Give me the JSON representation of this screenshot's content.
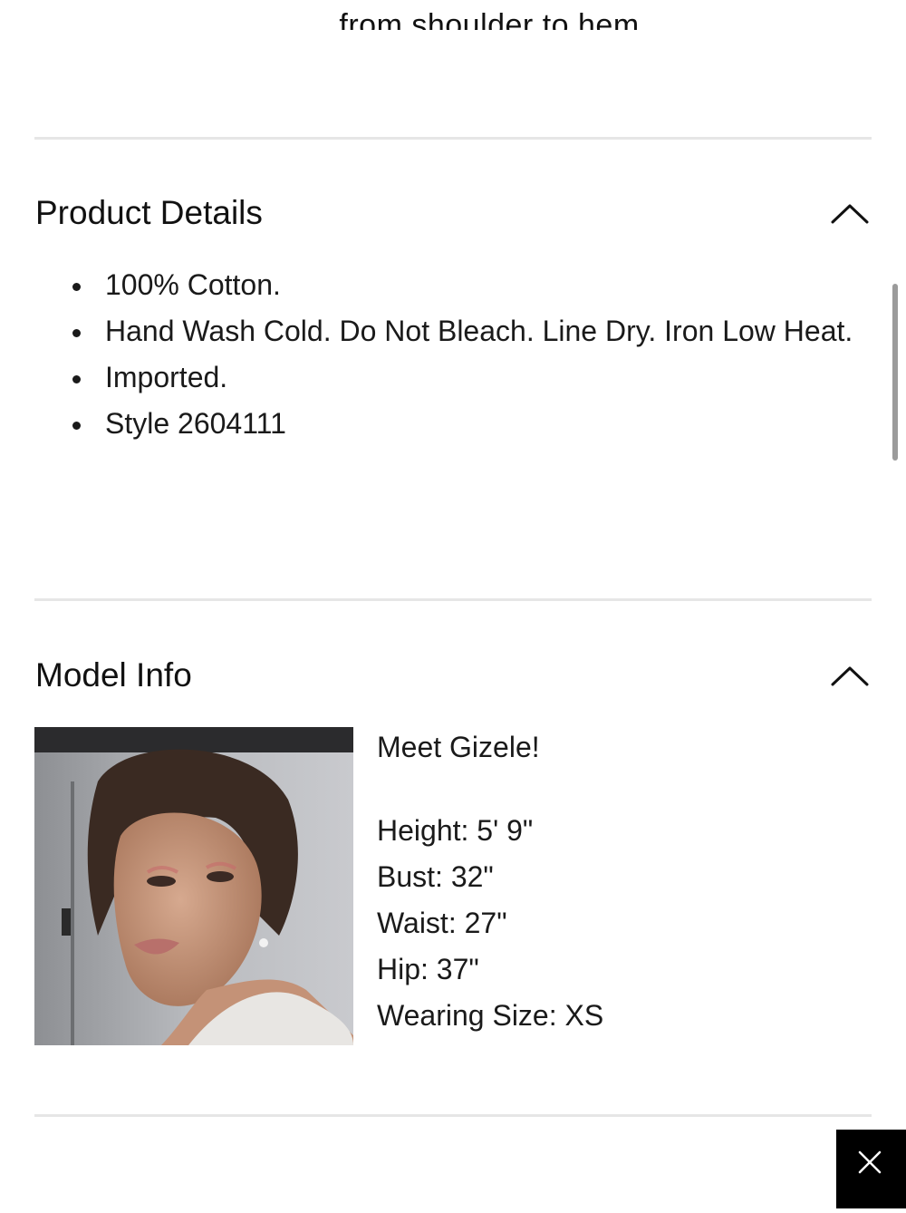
{
  "size_guide_tail": "from shoulder to hem.",
  "product_details": {
    "title": "Product Details",
    "toggle_icon": "chevron-up-icon",
    "items": [
      "100% Cotton.",
      "Hand Wash Cold. Do Not Bleach. Line Dry. Iron Low Heat.",
      "Imported.",
      "Style 2604111"
    ]
  },
  "model_info": {
    "title": "Model Info",
    "toggle_icon": "chevron-up-icon",
    "greeting": "Meet Gizele!",
    "stats": [
      "Height: 5' 9\"",
      "Bust: 32\"",
      "Waist: 27\"",
      "Hip: 37\"",
      "Wearing Size: XS"
    ]
  },
  "overlay": {
    "close_icon": "close-icon"
  },
  "colors": {
    "text": "#111111",
    "divider": "#e6e6e6",
    "close_bg": "#000000",
    "scrollbar": "#9b9b9b"
  }
}
